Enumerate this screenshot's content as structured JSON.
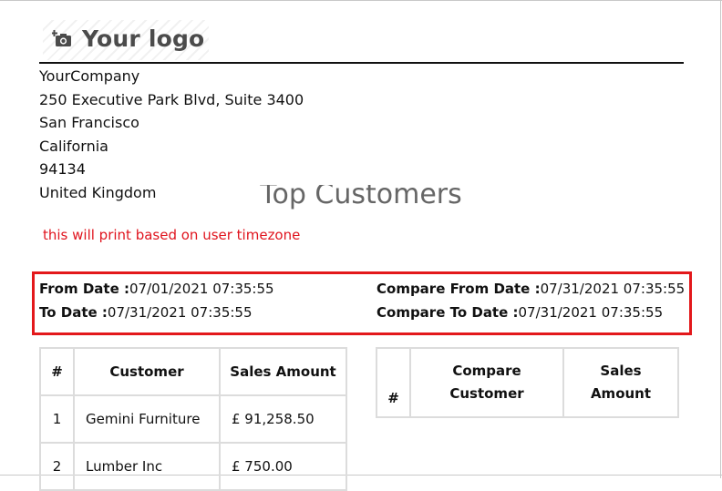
{
  "logo": {
    "text": "Your logo",
    "icon": "camera-icon"
  },
  "company": {
    "lines": [
      "YourCompany",
      "250 Executive Park Blvd, Suite 3400",
      "San Francisco",
      "California",
      "94134",
      "United Kingdom"
    ]
  },
  "report": {
    "title": "Top Customers",
    "timezone_note": "this will print based on user timezone"
  },
  "dates": {
    "from_label": "From Date :",
    "from_value": "07/01/2021 07:35:55",
    "to_label": "To Date :",
    "to_value": "07/31/2021 07:35:55",
    "compare_from_label": "Compare From Date :",
    "compare_from_value": "07/31/2021 07:35:55",
    "compare_to_label": "Compare To Date :",
    "compare_to_value": "07/31/2021 07:35:55"
  },
  "main_table": {
    "headers": [
      "#",
      "Customer",
      "Sales Amount"
    ],
    "rows": [
      [
        "1",
        "Gemini Furniture",
        "£ 91,258.50"
      ],
      [
        "2",
        "Lumber Inc",
        "£ 750.00"
      ]
    ]
  },
  "compare_table": {
    "headers": [
      "#",
      "Compare Customer",
      "Sales Amount"
    ]
  },
  "colors": {
    "highlight_border": "#e3181b",
    "note_text": "#e0141e"
  }
}
